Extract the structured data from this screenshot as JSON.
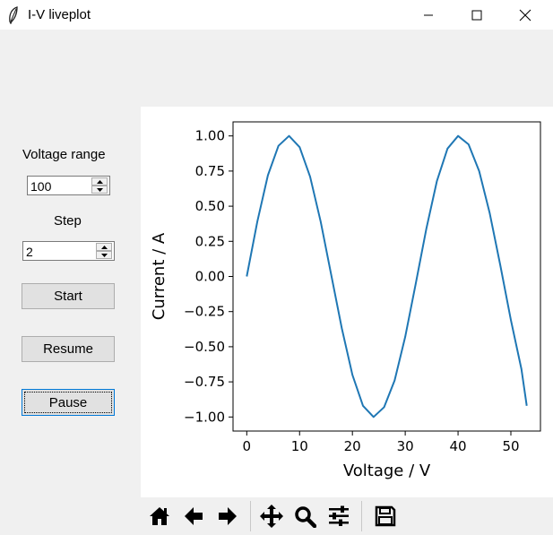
{
  "window": {
    "title": "I-V liveplot"
  },
  "controls": {
    "voltage_range_label": "Voltage range",
    "voltage_range_value": "100",
    "step_label": "Step",
    "step_value": "2",
    "start_label": "Start",
    "resume_label": "Resume",
    "pause_label": "Pause"
  },
  "toolbar": {
    "items": [
      "home-icon",
      "back-arrow-icon",
      "forward-arrow-icon",
      "pan-icon",
      "zoom-icon",
      "subplots-icon",
      "save-icon"
    ]
  },
  "colors": {
    "line": "#1f77b4"
  },
  "chart_data": {
    "type": "line",
    "xlabel": "Voltage / V",
    "ylabel": "Current / A",
    "xlim": [
      -2.6,
      55.6
    ],
    "ylim": [
      -1.1,
      1.1
    ],
    "xticks": [
      0,
      10,
      20,
      30,
      40,
      50
    ],
    "xtick_labels": [
      "0",
      "10",
      "20",
      "30",
      "40",
      "50"
    ],
    "yticks": [
      1.0,
      0.75,
      0.5,
      0.25,
      0.0,
      -0.25,
      -0.5,
      -0.75,
      -1.0
    ],
    "ytick_labels": [
      "1.00",
      "0.75",
      "0.50",
      "0.25",
      "0.00",
      "−0.25",
      "−0.50",
      "−0.75",
      "−1.00"
    ],
    "series": [
      {
        "x": [
          0,
          2,
          4,
          6,
          8,
          10,
          12,
          14,
          16,
          18,
          20,
          22,
          24,
          26,
          28,
          30,
          32,
          34,
          36,
          38,
          40,
          42,
          44,
          46,
          48,
          50,
          52,
          53
        ],
        "y": [
          0.0,
          0.39,
          0.72,
          0.93,
          1.0,
          0.92,
          0.71,
          0.39,
          0.01,
          -0.37,
          -0.7,
          -0.92,
          -1.0,
          -0.93,
          -0.74,
          -0.43,
          -0.05,
          0.34,
          0.68,
          0.91,
          1.0,
          0.94,
          0.75,
          0.45,
          0.08,
          -0.31,
          -0.66,
          -0.92
        ]
      }
    ],
    "grid": false
  }
}
